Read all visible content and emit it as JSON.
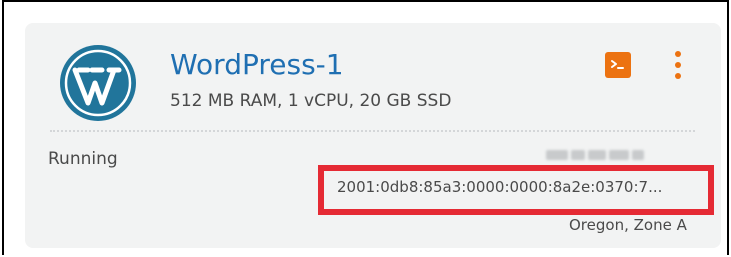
{
  "instance": {
    "name": "WordPress-1",
    "specs": "512 MB RAM, 1 vCPU, 20 GB SSD",
    "status": "Running",
    "ipv6": "2001:0db8:85a3:0000:0000:8a2e:0370:7...",
    "region": "Oregon, Zone A",
    "logo": "wordpress-logo"
  },
  "actions": {
    "terminal_icon": "terminal-icon",
    "terminal_glyph": ">_",
    "menu_icon": "kebab-menu-icon"
  },
  "colors": {
    "card_background": "#f2f3f3",
    "title_blue": "#1f6fb2",
    "accent_orange": "#ec7211",
    "highlight_red": "#e52a34",
    "logo_blue": "#21759b",
    "text_gray": "#4a4a4a"
  }
}
